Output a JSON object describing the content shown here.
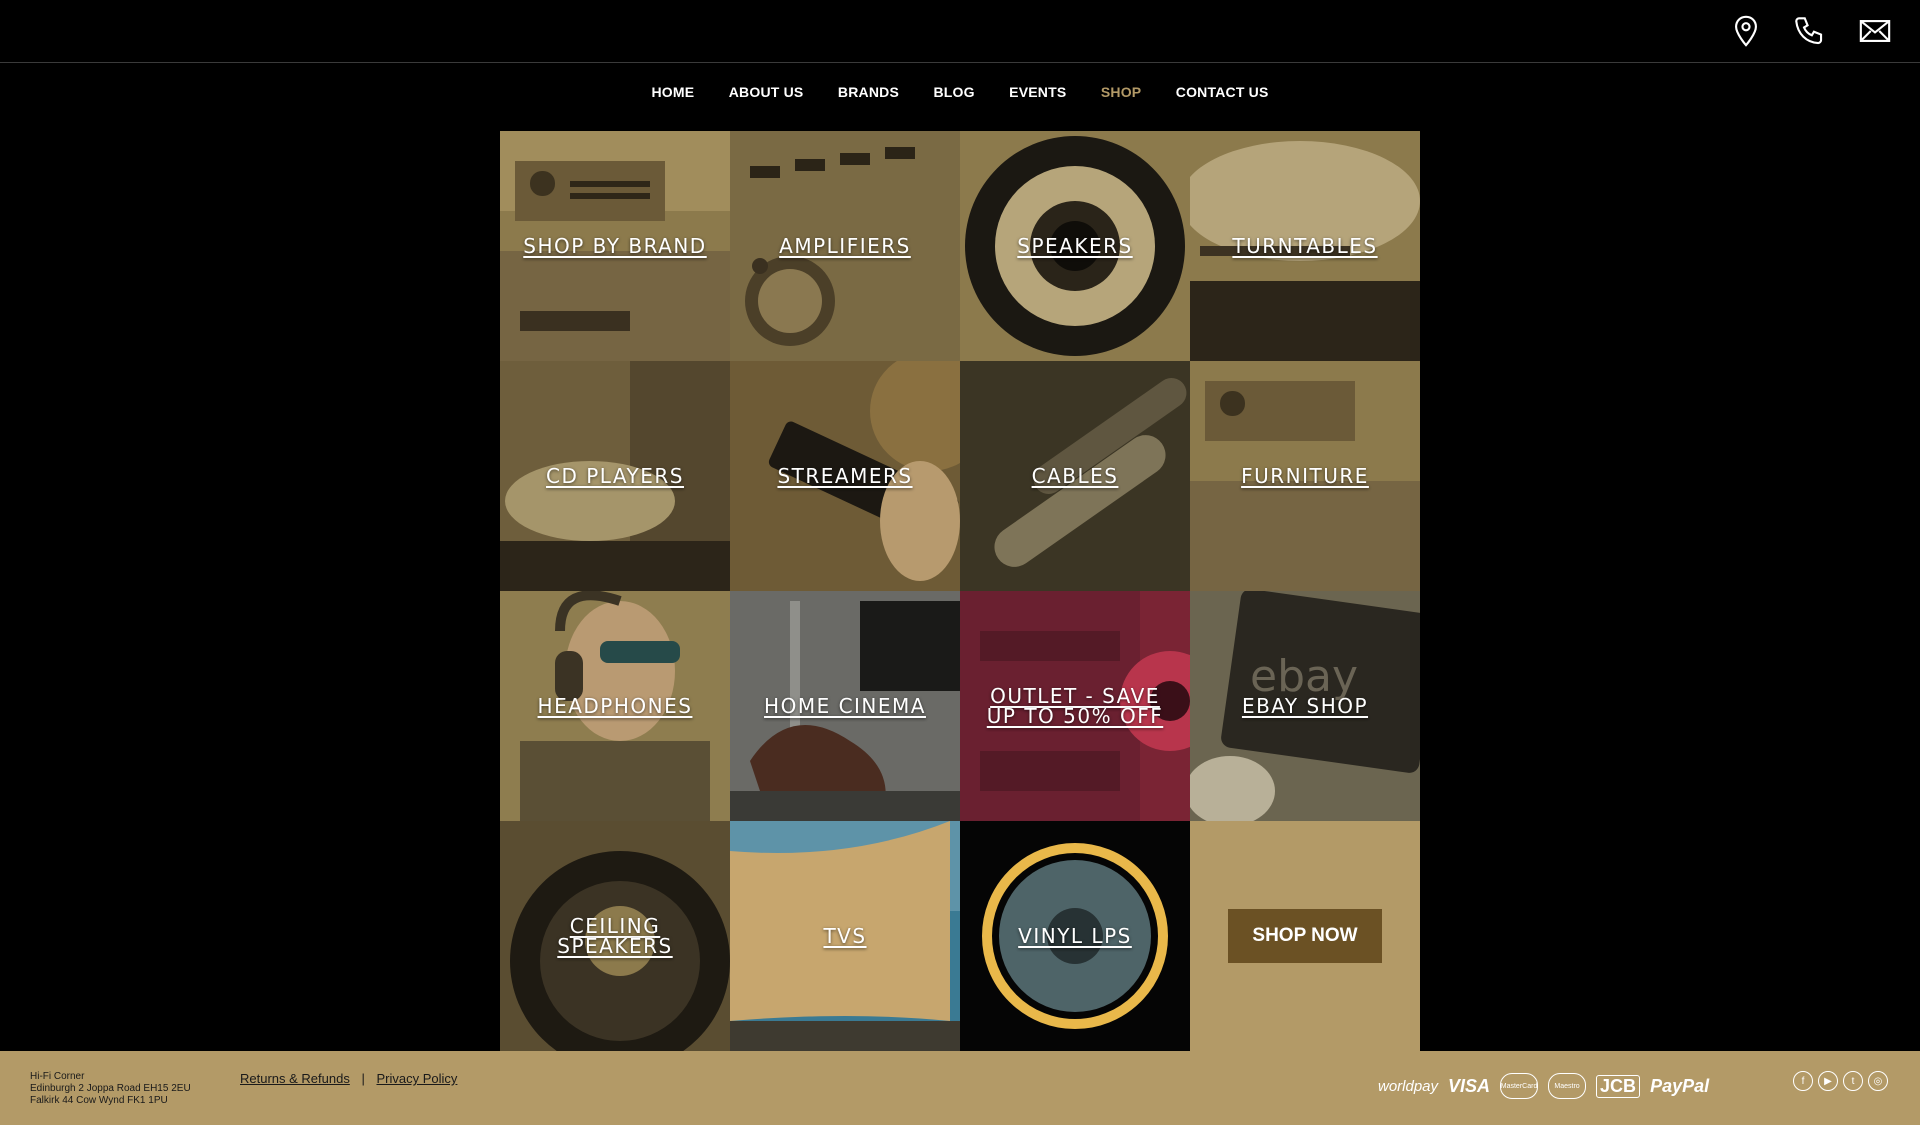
{
  "header": {
    "icons": [
      "location-icon",
      "phone-icon",
      "email-icon"
    ]
  },
  "nav": {
    "items": [
      "HOME",
      "ABOUT US",
      "BRANDS",
      "BLOG",
      "EVENTS",
      "SHOP",
      "CONTACT US"
    ],
    "active": "SHOP"
  },
  "tiles": [
    {
      "label": "SHOP BY BRAND",
      "icon": "hifi-unit-photo"
    },
    {
      "label": "AMPLIFIERS",
      "icon": "amplifier-photo"
    },
    {
      "label": "SPEAKERS",
      "icon": "speaker-photo"
    },
    {
      "label": "TURNTABLES",
      "icon": "turntable-photo"
    },
    {
      "label": "CD PLAYERS",
      "icon": "cd-player-photo"
    },
    {
      "label": "STREAMERS",
      "icon": "phone-photo"
    },
    {
      "label": "CABLES",
      "icon": "cables-photo"
    },
    {
      "label": "FURNITURE",
      "icon": "furniture-photo"
    },
    {
      "label": "HEADPHONES",
      "icon": "headphones-photo"
    },
    {
      "label": "HOME CINEMA",
      "icon": "home-cinema-photo"
    },
    {
      "label": "OUTLET - SAVE UP TO 50% OFF",
      "icon": "outlet-photo"
    },
    {
      "label": "EBAY SHOP",
      "icon": "ebay-tablet-photo",
      "image_text": "ebay"
    },
    {
      "label": "CEILING SPEAKERS",
      "icon": "ceiling-speaker-photo"
    },
    {
      "label": "TVS",
      "icon": "tv-photo"
    },
    {
      "label": "VINYL LPS",
      "icon": "vinyl-photo"
    }
  ],
  "shop_now_label": "SHOP NOW",
  "footer": {
    "address": [
      "Hi-Fi Corner",
      "Edinburgh 2 Joppa Road EH15 2EU",
      "Falkirk 44 Cow Wynd FK1 1PU"
    ],
    "links": [
      "Returns & Refunds",
      "Privacy Policy"
    ],
    "separator": "|",
    "payments": [
      "worldpay",
      "VISA",
      "MasterCard",
      "Maestro",
      "JCB",
      "PayPal"
    ],
    "social": [
      "facebook-icon",
      "youtube-icon",
      "twitter-icon",
      "instagram-icon"
    ]
  },
  "colors": {
    "background": "#000000",
    "accent": "#b39a67",
    "button": "#6b5124",
    "outlet_tint": "#7a2434"
  }
}
